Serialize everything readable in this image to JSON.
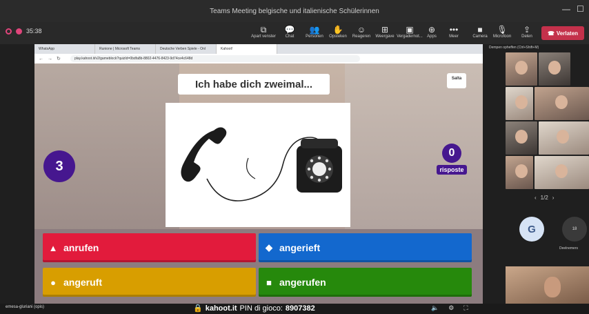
{
  "window": {
    "title": "Teams Meeting belgische und italienische Schülerinnen",
    "elapsed": "35:38"
  },
  "toolbar": {
    "items": [
      {
        "label": "Apart venster",
        "icon": "popout-icon"
      },
      {
        "label": "Chat",
        "icon": "chat-icon"
      },
      {
        "label": "Personen",
        "icon": "people-icon"
      },
      {
        "label": "Opsteken",
        "icon": "raise-hand-icon"
      },
      {
        "label": "Reageren",
        "icon": "react-icon"
      },
      {
        "label": "Weergave",
        "icon": "view-icon"
      },
      {
        "label": "Vergadernot...",
        "icon": "notes-icon"
      },
      {
        "label": "Apps",
        "icon": "apps-icon"
      },
      {
        "label": "Meer",
        "icon": "more-icon"
      },
      {
        "label": "Camera",
        "icon": "camera-icon"
      },
      {
        "label": "Microfoon",
        "icon": "microphone-icon"
      },
      {
        "label": "Delen",
        "icon": "share-icon"
      }
    ],
    "leave_label": "Verlaten"
  },
  "browser": {
    "tabs": [
      "WhatsApp",
      "Runione | Microsoft Teams",
      "Deutsche Verben Spiele - Onl",
      "Kahoot!"
    ],
    "url": "play.kahoot.it/v2/gameblock?quizId=0bdfa8b-8802-4476-8423-9d74ce4c648d"
  },
  "kahoot": {
    "question": "Ich habe dich zweimal...",
    "skip_label": "Salta",
    "timer": "3",
    "answers_count": "0",
    "answers_label": "risposte",
    "answers": [
      {
        "label": "anrufen",
        "shape": "▲",
        "color": "#e21b3c",
        "shape_name": "triangle-icon"
      },
      {
        "label": "angerieft",
        "shape": "◆",
        "color": "#1368ce",
        "shape_name": "diamond-icon"
      },
      {
        "label": "angeruft",
        "shape": "●",
        "color": "#d89e00",
        "shape_name": "circle-icon"
      },
      {
        "label": "angerufen",
        "shape": "■",
        "color": "#26890c",
        "shape_name": "square-icon"
      }
    ],
    "footer_domain": "kahoot.it",
    "pin_label": "PIN di gioco:",
    "pin": "8907382"
  },
  "presenter": "emesa-gluriani (opis)",
  "panel": {
    "note": "Dempen opheffen (Ctrl+Shift+M)",
    "pager": {
      "prev": "‹",
      "label": "1/2",
      "next": "›"
    },
    "avatar_initial": "G",
    "overflow_count": "18",
    "overflow_label": "Deelnemers"
  },
  "colors": {
    "kahoot_purple": "#46178f",
    "leave_red": "#c4314b"
  }
}
